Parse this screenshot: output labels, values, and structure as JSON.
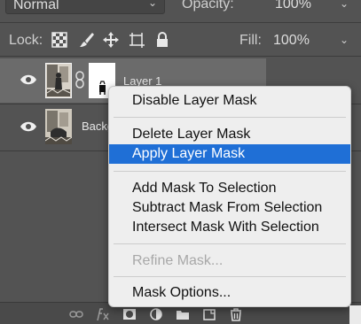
{
  "blend": {
    "mode": "Normal",
    "opacity_label": "Opacity:",
    "opacity_value": "100%"
  },
  "lock": {
    "label": "Lock:",
    "fill_label": "Fill:",
    "fill_value": "100%"
  },
  "layers": [
    {
      "name": "Layer 1",
      "visible": true,
      "selected": true,
      "has_mask": true
    },
    {
      "name": "Background",
      "visible": true,
      "selected": false,
      "has_mask": false
    }
  ],
  "context_menu": {
    "items": [
      {
        "label": "Disable Layer Mask",
        "state": "normal"
      },
      {
        "label": "Delete Layer Mask",
        "state": "normal"
      },
      {
        "label": "Apply Layer Mask",
        "state": "highlighted"
      },
      {
        "label": "Add Mask To Selection",
        "state": "normal"
      },
      {
        "label": "Subtract Mask From Selection",
        "state": "normal"
      },
      {
        "label": "Intersect Mask With Selection",
        "state": "normal"
      },
      {
        "label": "Refine Mask...",
        "state": "disabled"
      },
      {
        "label": "Mask Options...",
        "state": "normal"
      }
    ]
  },
  "toolbar_icons": [
    "link-icon",
    "fx-icon",
    "add-mask-icon",
    "adjustment-icon",
    "folder-icon",
    "new-layer-icon",
    "trash-icon"
  ],
  "colors": {
    "panel_bg": "#535353",
    "selected_row": "#6b6b6b",
    "menu_bg": "#eeeeee",
    "menu_highlight": "#1f6fd6",
    "menu_disabled": "#a8a8a8"
  }
}
